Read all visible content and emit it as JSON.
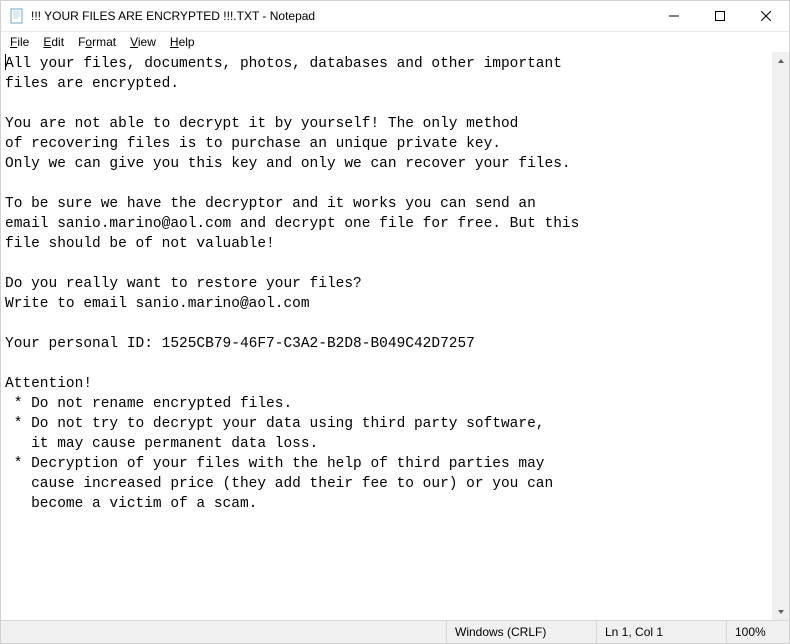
{
  "window": {
    "title": "!!! YOUR FILES ARE ENCRYPTED !!!.TXT - Notepad"
  },
  "menu": {
    "file": "File",
    "edit": "Edit",
    "format": "Format",
    "view": "View",
    "help": "Help"
  },
  "document": {
    "body": "All your files, documents, photos, databases and other important\nfiles are encrypted.\n\nYou are not able to decrypt it by yourself! The only method\nof recovering files is to purchase an unique private key.\nOnly we can give you this key and only we can recover your files.\n\nTo be sure we have the decryptor and it works you can send an\nemail sanio.marino@aol.com and decrypt one file for free. But this\nfile should be of not valuable!\n\nDo you really want to restore your files?\nWrite to email sanio.marino@aol.com\n\nYour personal ID: 1525CB79-46F7-C3A2-B2D8-B049C42D7257\n\nAttention!\n * Do not rename encrypted files.\n * Do not try to decrypt your data using third party software,\n   it may cause permanent data loss.\n * Decryption of your files with the help of third parties may\n   cause increased price (they add their fee to our) or you can\n   become a victim of a scam.\n"
  },
  "statusbar": {
    "encoding": "Windows (CRLF)",
    "position": "Ln 1, Col 1",
    "zoom": "100%"
  }
}
